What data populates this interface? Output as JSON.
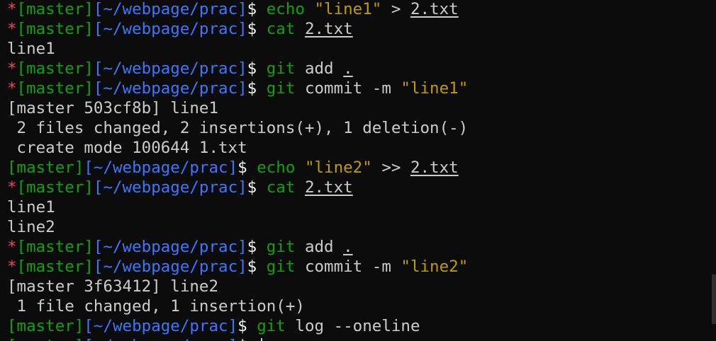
{
  "prompt": {
    "star": "*",
    "branch": "[master]",
    "path": "[~/webpage/prac]",
    "dollar": "$"
  },
  "lines": [
    {
      "type": "cmd",
      "star": true,
      "parts": [
        {
          "text": "echo ",
          "c": "green"
        },
        {
          "text": "\"line1\"",
          "c": "yellow"
        },
        {
          "text": " > ",
          "c": "plain"
        },
        {
          "text": "2.txt",
          "c": "file"
        }
      ]
    },
    {
      "type": "cmd",
      "star": true,
      "parts": [
        {
          "text": "cat ",
          "c": "green"
        },
        {
          "text": "2.txt",
          "c": "file"
        }
      ]
    },
    {
      "type": "out",
      "text": "line1"
    },
    {
      "type": "cmd",
      "star": true,
      "parts": [
        {
          "text": "git ",
          "c": "green"
        },
        {
          "text": "add ",
          "c": "plain"
        },
        {
          "text": ".",
          "c": "file"
        }
      ]
    },
    {
      "type": "cmd",
      "star": true,
      "parts": [
        {
          "text": "git ",
          "c": "green"
        },
        {
          "text": "commit -m ",
          "c": "plain"
        },
        {
          "text": "\"line1\"",
          "c": "yellow"
        }
      ]
    },
    {
      "type": "out",
      "text": "[master 503cf8b] line1"
    },
    {
      "type": "out",
      "text": " 2 files changed, 2 insertions(+), 1 deletion(-)"
    },
    {
      "type": "out",
      "text": " create mode 100644 1.txt"
    },
    {
      "type": "cmd",
      "star": false,
      "parts": [
        {
          "text": "echo ",
          "c": "green"
        },
        {
          "text": "\"line2\"",
          "c": "yellow"
        },
        {
          "text": " >> ",
          "c": "plain"
        },
        {
          "text": "2.txt",
          "c": "file"
        }
      ]
    },
    {
      "type": "cmd",
      "star": true,
      "parts": [
        {
          "text": "cat ",
          "c": "green"
        },
        {
          "text": "2.txt",
          "c": "file"
        }
      ]
    },
    {
      "type": "out",
      "text": "line1"
    },
    {
      "type": "out",
      "text": "line2"
    },
    {
      "type": "cmd",
      "star": true,
      "parts": [
        {
          "text": "git ",
          "c": "green"
        },
        {
          "text": "add ",
          "c": "plain"
        },
        {
          "text": ".",
          "c": "file"
        }
      ]
    },
    {
      "type": "cmd",
      "star": true,
      "parts": [
        {
          "text": "git ",
          "c": "green"
        },
        {
          "text": "commit -m ",
          "c": "plain"
        },
        {
          "text": "\"line2\"",
          "c": "yellow"
        }
      ]
    },
    {
      "type": "out",
      "text": "[master 3f63412] line2"
    },
    {
      "type": "out",
      "text": " 1 file changed, 1 insertion(+)"
    },
    {
      "type": "cmd",
      "star": false,
      "parts": [
        {
          "text": "git ",
          "c": "green"
        },
        {
          "text": "log --oneline",
          "c": "plain"
        }
      ]
    },
    {
      "type": "cmd",
      "star": false,
      "cursor": true,
      "parts": []
    }
  ]
}
